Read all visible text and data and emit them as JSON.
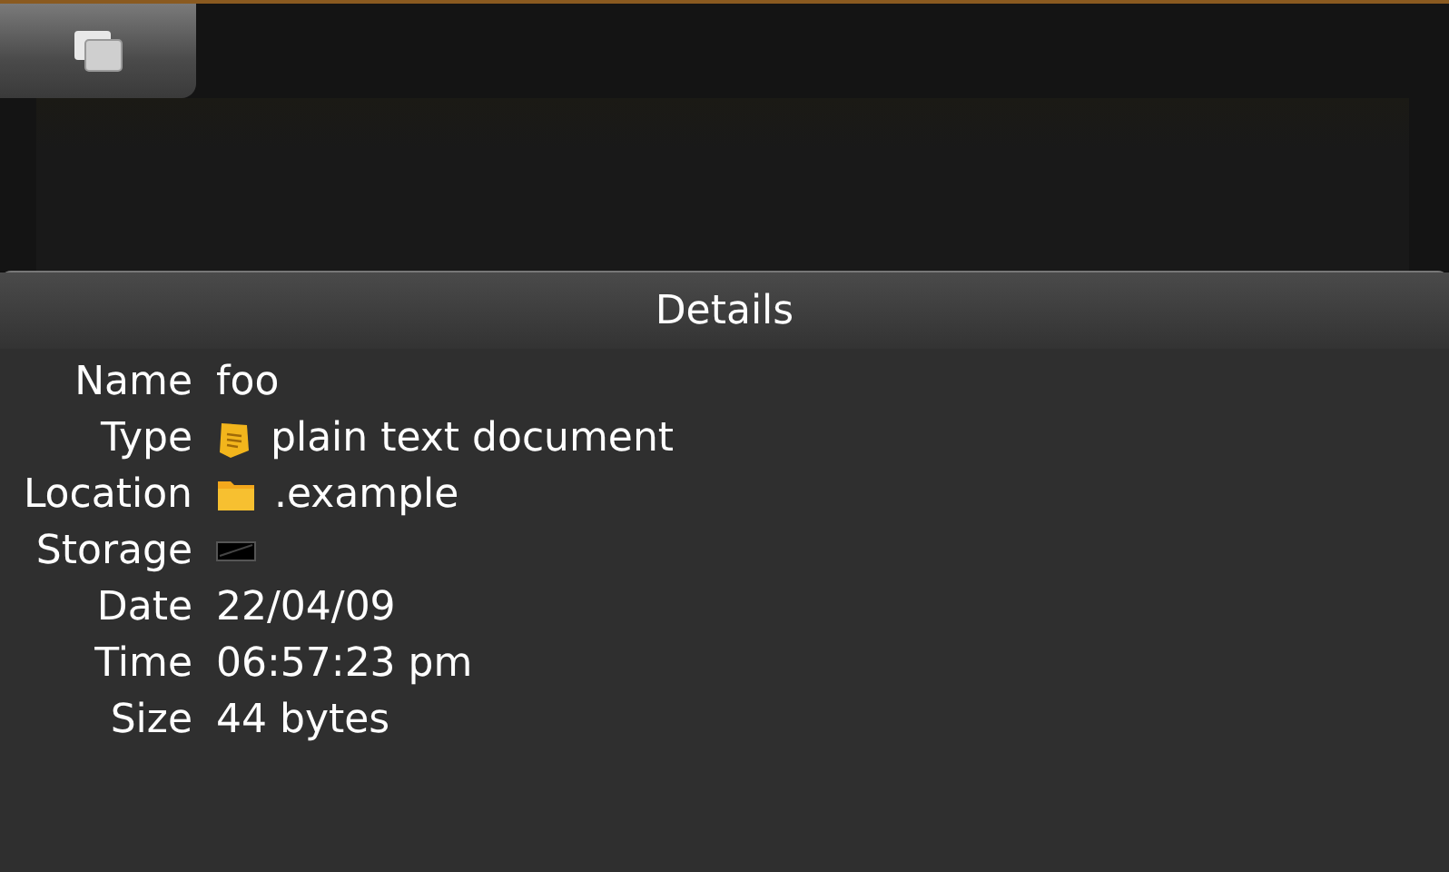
{
  "dialog": {
    "title": "Details",
    "rows": [
      {
        "label": "Name",
        "kind": "plain",
        "value": "foo"
      },
      {
        "label": "Type",
        "kind": "document",
        "value": "plain text document"
      },
      {
        "label": "Location",
        "kind": "folder",
        "value": ".example"
      },
      {
        "label": "Storage",
        "kind": "drive"
      },
      {
        "label": "Date",
        "kind": "plain",
        "value": "22/04/09"
      },
      {
        "label": "Time",
        "kind": "plain",
        "value": "06:57:23 pm"
      },
      {
        "label": "Size",
        "kind": "plain",
        "value": "44 bytes"
      }
    ]
  }
}
